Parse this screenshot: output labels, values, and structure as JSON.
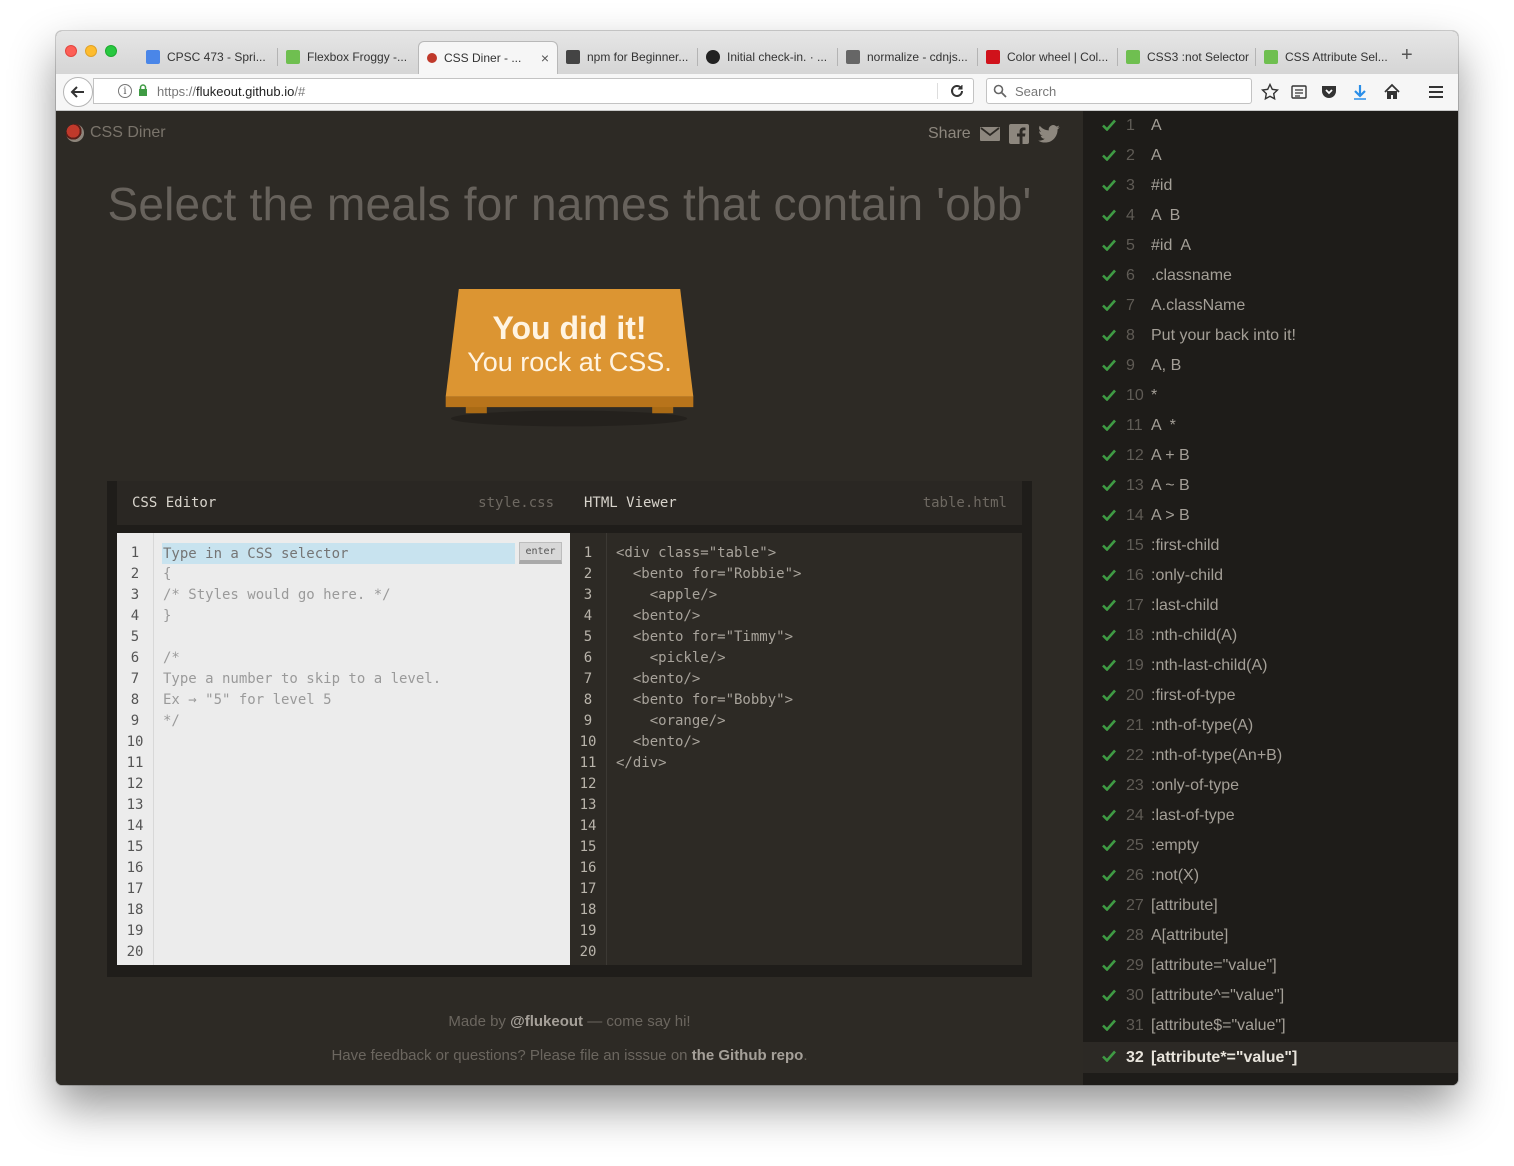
{
  "browser": {
    "tabs": [
      {
        "label": "CPSC 473 - Spri...",
        "icon": "document-icon",
        "color": "#4a86e8",
        "active": false
      },
      {
        "label": "Flexbox Froggy -...",
        "icon": "frog-icon",
        "color": "#6fbf50",
        "active": false
      },
      {
        "label": "CSS Diner - ...",
        "icon": "plate-icon",
        "color": "#c0392b",
        "active": true
      },
      {
        "label": "npm for Beginner...",
        "icon": "iw-icon",
        "color": "#444444",
        "active": false
      },
      {
        "label": "Initial check-in. · ...",
        "icon": "github-icon",
        "color": "#222222",
        "active": false
      },
      {
        "label": "normalize - cdnjs...",
        "icon": "c-icon",
        "color": "#666666",
        "active": false
      },
      {
        "label": "Color wheel | Col...",
        "icon": "adobe-icon",
        "color": "#d0121b",
        "active": false
      },
      {
        "label": "CSS3 :not Selector",
        "icon": "w3c-icon",
        "color": "#6fbf50",
        "active": false
      },
      {
        "label": "CSS Attribute Sel...",
        "icon": "w3c-icon",
        "color": "#6fbf50",
        "active": false
      }
    ],
    "url_prefix": "https://",
    "url_host": "flukeout.github.io",
    "url_path": "/#",
    "search_placeholder": "Search"
  },
  "app": {
    "logo_text": "CSS Diner",
    "share_label": "Share",
    "headline": "Select the meals for names that contain 'obb'",
    "win_line1": "You did it!",
    "win_line2": "You rock at CSS."
  },
  "css_editor": {
    "title": "CSS Editor",
    "filename": "style.css",
    "input_placeholder": "Type in a CSS selector",
    "enter_label": "enter",
    "lines": [
      "",
      "{",
      "/* Styles would go here. */",
      "}",
      "",
      "/*",
      "Type a number to skip to a level.",
      "Ex → \"5\" for level 5",
      "*/"
    ],
    "line_count": 20
  },
  "html_viewer": {
    "title": "HTML Viewer",
    "filename": "table.html",
    "lines": [
      "<div class=\"table\">",
      "  <bento for=\"Robbie\">",
      "    <apple/>",
      "  <bento/>",
      "  <bento for=\"Timmy\">",
      "    <pickle/>",
      "  <bento/>",
      "  <bento for=\"Bobby\">",
      "    <orange/>",
      "  <bento/>",
      "</div>"
    ],
    "line_count": 20
  },
  "footer": {
    "made_by_prefix": "Made by ",
    "made_by_handle": "@flukeout",
    "made_by_suffix": " — come say hi!",
    "feedback_prefix": "Have feedback or questions? Please file an isssue on ",
    "feedback_link": "the Github repo",
    "feedback_suffix": "."
  },
  "levels": [
    {
      "num": "1",
      "name": "A"
    },
    {
      "num": "2",
      "name": "A"
    },
    {
      "num": "3",
      "name": "#id"
    },
    {
      "num": "4",
      "name": "A  B"
    },
    {
      "num": "5",
      "name": "#id  A"
    },
    {
      "num": "6",
      "name": ".classname"
    },
    {
      "num": "7",
      "name": "A.className"
    },
    {
      "num": "8",
      "name": "Put your back into it!"
    },
    {
      "num": "9",
      "name": "A, B"
    },
    {
      "num": "10",
      "name": "*"
    },
    {
      "num": "11",
      "name": "A  *"
    },
    {
      "num": "12",
      "name": "A + B"
    },
    {
      "num": "13",
      "name": "A ~ B"
    },
    {
      "num": "14",
      "name": "A > B"
    },
    {
      "num": "15",
      "name": ":first-child"
    },
    {
      "num": "16",
      "name": ":only-child"
    },
    {
      "num": "17",
      "name": ":last-child"
    },
    {
      "num": "18",
      "name": ":nth-child(A)"
    },
    {
      "num": "19",
      "name": ":nth-last-child(A)"
    },
    {
      "num": "20",
      "name": ":first-of-type"
    },
    {
      "num": "21",
      "name": ":nth-of-type(A)"
    },
    {
      "num": "22",
      "name": ":nth-of-type(An+B)"
    },
    {
      "num": "23",
      "name": ":only-of-type"
    },
    {
      "num": "24",
      "name": ":last-of-type"
    },
    {
      "num": "25",
      "name": ":empty"
    },
    {
      "num": "26",
      "name": ":not(X)"
    },
    {
      "num": "27",
      "name": "[attribute]"
    },
    {
      "num": "28",
      "name": "A[attribute]"
    },
    {
      "num": "29",
      "name": "[attribute=\"value\"]"
    },
    {
      "num": "30",
      "name": "[attribute^=\"value\"]"
    },
    {
      "num": "31",
      "name": "[attribute$=\"value\"]"
    },
    {
      "num": "32",
      "name": "[attribute*=\"value\"]",
      "current": true
    }
  ],
  "colors": {
    "check": "#3f9b44",
    "table_orange": "#dd9530",
    "page_bg": "#2d2a25"
  }
}
